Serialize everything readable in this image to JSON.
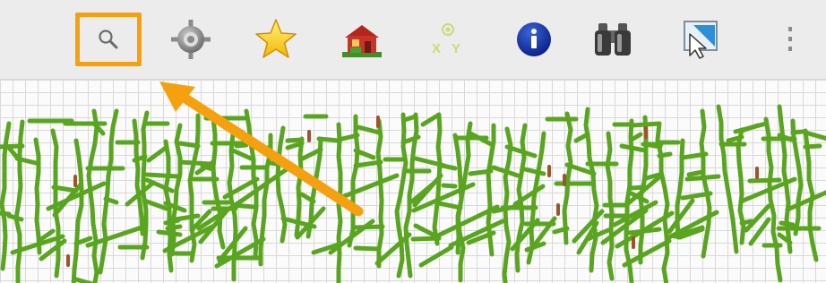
{
  "toolbar": {
    "background": "#ececec",
    "tools": [
      {
        "name": "search-icon",
        "selected": true
      },
      {
        "name": "locate-crosshair-icon",
        "selected": false
      },
      {
        "name": "favorites-star-icon",
        "selected": false
      },
      {
        "name": "home-house-icon",
        "selected": false
      },
      {
        "name": "xy-coordinates-icon",
        "label": "X Y",
        "selected": false
      },
      {
        "name": "info-icon",
        "selected": false
      },
      {
        "name": "binoculars-icon",
        "selected": false
      },
      {
        "name": "select-cursor-icon",
        "selected": false
      },
      {
        "name": "more-vertical-icon",
        "selected": false
      }
    ]
  },
  "annotation": {
    "highlight_color": "#f5a00f",
    "arrow_color": "#f5a00f",
    "points_to": "search-icon"
  },
  "map": {
    "grid_color": "#d9d9d9",
    "network_color": "#5aa51f",
    "accent_color": "#a0522d"
  }
}
